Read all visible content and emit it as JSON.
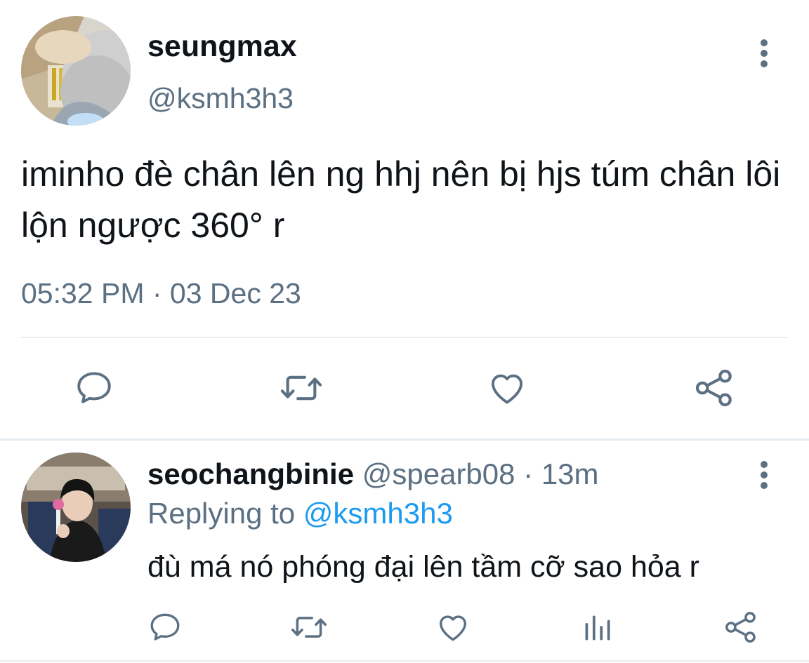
{
  "tweet": {
    "display_name": "seungmax",
    "handle": "@ksmh3h3",
    "text": "iminho đè chân lên ng hhj nên bị hjs túm chân lôi lộn ngược 360° r",
    "timestamp": "05:32 PM · 03 Dec 23",
    "actions": [
      "reply-icon",
      "retweet-icon",
      "like-icon",
      "share-icon"
    ]
  },
  "reply": {
    "display_name": "seochangbinie",
    "meta": " @spearb08 · 13m",
    "replying_prefix": "Replying to ",
    "replying_to": "@ksmh3h3",
    "text": "đù má nó phóng đại lên tầm cỡ sao hỏa r",
    "actions": [
      "reply-icon",
      "retweet-icon",
      "like-icon",
      "analytics-icon",
      "share-icon"
    ]
  },
  "colors": {
    "text_primary": "#0f1419",
    "text_secondary": "#5b7083",
    "link": "#1d9bf0",
    "divider": "#e6ecf0"
  }
}
